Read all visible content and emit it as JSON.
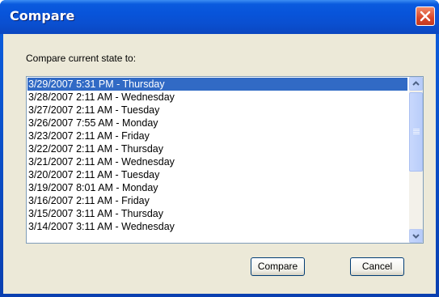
{
  "window": {
    "title": "Compare"
  },
  "prompt": "Compare current state to:",
  "list": {
    "items": [
      "3/29/2007 5:31 PM - Thursday",
      "3/28/2007 2:11 AM - Wednesday",
      "3/27/2007 2:11 AM - Tuesday",
      "3/26/2007 7:55 AM - Monday",
      "3/23/2007 2:11 AM - Friday",
      "3/22/2007 2:11 AM - Thursday",
      "3/21/2007 2:11 AM - Wednesday",
      "3/20/2007 2:11 AM - Tuesday",
      "3/19/2007 8:01 AM - Monday",
      "3/16/2007 2:11 AM - Friday",
      "3/15/2007 3:11 AM - Thursday",
      "3/14/2007 3:11 AM - Wednesday"
    ],
    "selected_index": 0
  },
  "buttons": {
    "compare": "Compare",
    "cancel": "Cancel"
  },
  "colors": {
    "selection": "#316ac5",
    "title_bar": "#0a5ade",
    "dialog_bg": "#ece9d8",
    "close_button": "#d8462a"
  },
  "icons": {
    "close": "close-icon",
    "scroll_up": "chevron-up-icon",
    "scroll_down": "chevron-down-icon"
  }
}
